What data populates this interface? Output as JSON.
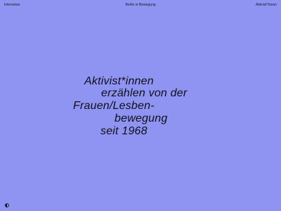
{
  "nav": {
    "left": "Interviews",
    "center": "Berlin in Bewegung",
    "right": "Aktivist*innen"
  },
  "hero": {
    "lines": [
      "Aktivist*innen",
      "erzählen von der",
      "Frauen/Lesben-",
      "bewegung",
      "seit 1968"
    ]
  },
  "footer": {
    "toggle_icon": "half-circle-contrast-icon"
  },
  "colors": {
    "background": "#8F93F2",
    "text": "#101018"
  }
}
